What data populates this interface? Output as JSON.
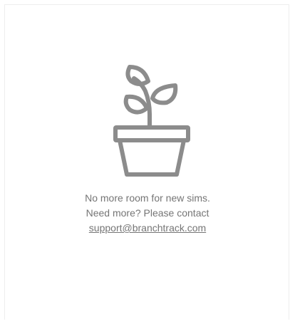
{
  "empty_state": {
    "icon": "plant-in-pot-icon",
    "line1": "No more room for new sims.",
    "line2": "Need more? Please contact",
    "support_email": "support@branchtrack.com"
  },
  "colors": {
    "icon_stroke": "#8c8c8c",
    "text": "#757575",
    "card_border": "#eeeeee"
  }
}
